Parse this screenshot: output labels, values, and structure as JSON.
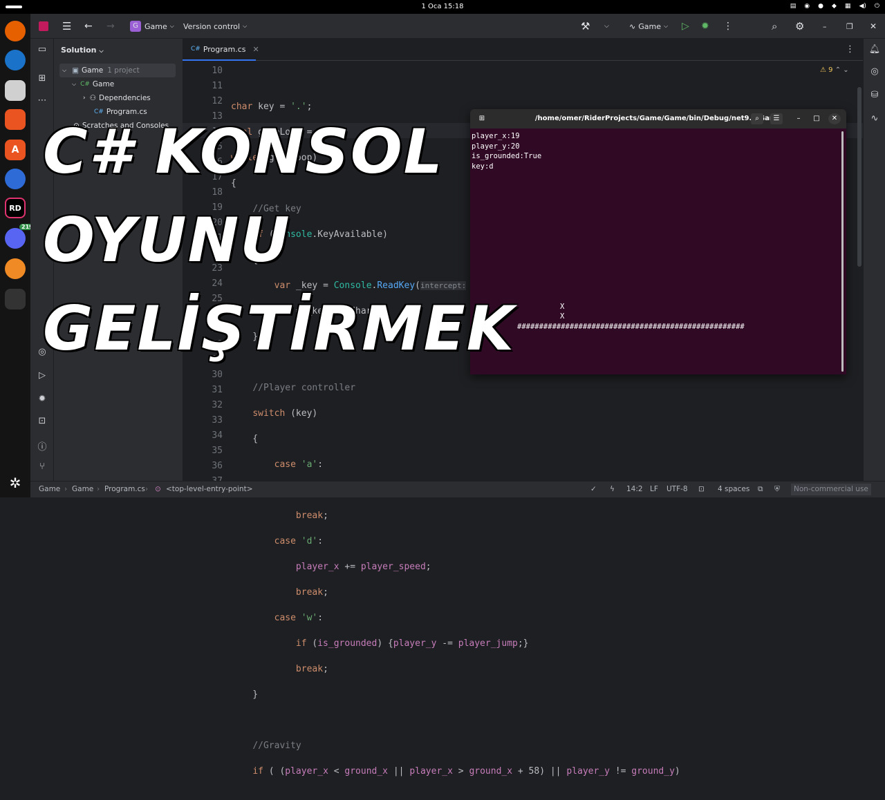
{
  "system": {
    "clock": "1 Oca  15:18"
  },
  "titlebar": {
    "project": "Game",
    "project_badge": "G",
    "vcs": "Version control",
    "run_config": "Game"
  },
  "sidebar": {
    "header": "Solution",
    "items": [
      {
        "label": "Game",
        "note": "1 project"
      },
      {
        "label": "Game",
        "icon": "C#"
      },
      {
        "label": "Dependencies"
      },
      {
        "label": "Program.cs",
        "icon": "C#"
      },
      {
        "label": "Scratches and Consoles"
      }
    ]
  },
  "editor": {
    "tab_icon": "C#",
    "tab": "Program.cs",
    "warnings": "9",
    "line_numbers": [
      "10",
      "11",
      "12",
      "13",
      "14",
      "15",
      "16",
      "17",
      "18",
      "19",
      "20",
      "21",
      "22",
      "23",
      "24",
      "25",
      "26",
      "27",
      "28",
      "29",
      "30",
      "31",
      "32",
      "33",
      "34",
      "35",
      "36",
      "37"
    ],
    "hint": "intercept:"
  },
  "terminal": {
    "title": "/home/omer/RiderProjects/Game/Game/bin/Debug/net9.0/Game",
    "lines": [
      "player_x:19",
      "player_y:20",
      "is_grounded:True",
      "key:d",
      "",
      "",
      "",
      "",
      "",
      "",
      "",
      "",
      "",
      "",
      "",
      "",
      "",
      "X",
      "X",
      "####################################################"
    ]
  },
  "status": {
    "crumbs": [
      "Game",
      "Game",
      "Program.cs",
      "<top-level-entry-point>"
    ],
    "position": "14:2",
    "line_ending": "LF",
    "encoding": "UTF-8",
    "indent": "4 spaces",
    "license": "Non-commercial use"
  },
  "overlay": {
    "line1": "C# KONSOL",
    "line2": "OYUNU",
    "line3": "GELİŞTİRMEK"
  },
  "dock": {
    "badge": "219",
    "rider_label": "RD"
  }
}
